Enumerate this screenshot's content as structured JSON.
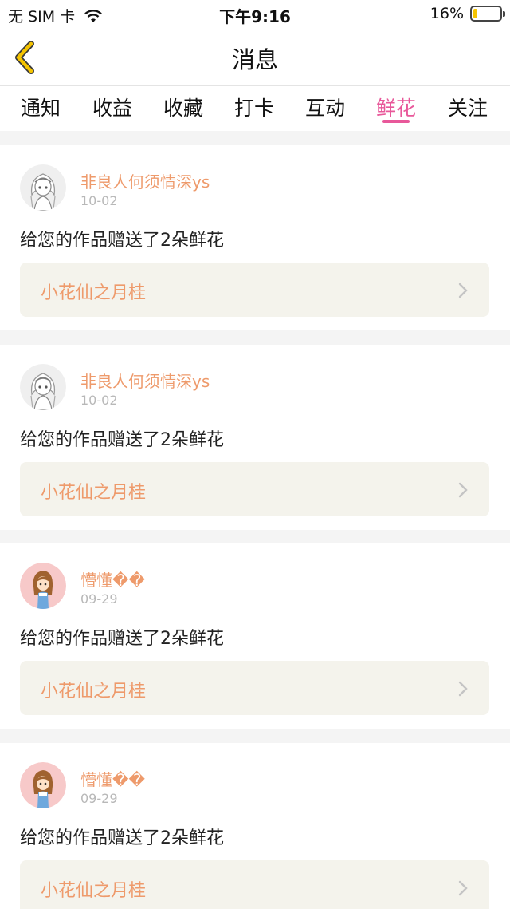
{
  "status_bar": {
    "carrier": "无 SIM 卡",
    "time": "下午9:16",
    "battery_percent": "16%",
    "battery_level": 0.16,
    "battery_color": "#f5c400"
  },
  "nav": {
    "title": "消息",
    "back_icon": "chevron-left-icon",
    "accent_color": "#f5c400"
  },
  "tabs": [
    {
      "label": "通知"
    },
    {
      "label": "收益"
    },
    {
      "label": "收藏"
    },
    {
      "label": "打卡"
    },
    {
      "label": "互动"
    },
    {
      "label": "鲜花",
      "active": true
    },
    {
      "label": "关注"
    }
  ],
  "active_tab_color": "#e8589a",
  "messages": [
    {
      "username": "非良人何须情深ys",
      "date": "10-02",
      "text": "给您的作品赠送了2朵鲜花",
      "work_title": "小花仙之月桂",
      "avatar": "sketch-girl-avatar"
    },
    {
      "username": "非良人何须情深ys",
      "date": "10-02",
      "text": "给您的作品赠送了2朵鲜花",
      "work_title": "小花仙之月桂",
      "avatar": "sketch-girl-avatar"
    },
    {
      "username": "懵懂��",
      "date": "09-29",
      "text": "给您的作品赠送了2朵鲜花",
      "work_title": "小花仙之月桂",
      "avatar": "cartoon-girl-avatar"
    },
    {
      "username": "懵懂��",
      "date": "09-29",
      "text": "给您的作品赠送了2朵鲜花",
      "work_title": "小花仙之月桂",
      "avatar": "cartoon-girl-avatar"
    }
  ]
}
